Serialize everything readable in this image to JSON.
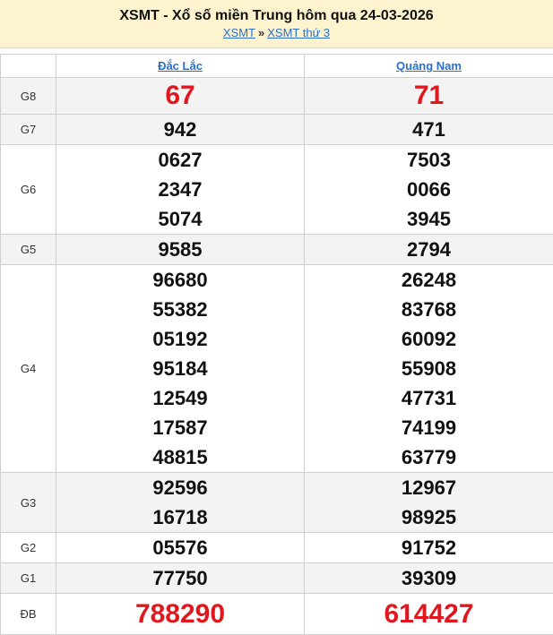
{
  "header": {
    "title": "XSMT - Xổ số miền Trung hôm qua 24-03-2026",
    "breadcrumb": [
      "XSMT",
      "XSMT thứ 3"
    ],
    "separator": "»"
  },
  "provinces": [
    "Đắc Lắc",
    "Quảng Nam"
  ],
  "rows": [
    {
      "label": "G8",
      "cells": [
        [
          "67"
        ],
        [
          "71"
        ]
      ]
    },
    {
      "label": "G7",
      "cells": [
        [
          "942"
        ],
        [
          "471"
        ]
      ]
    },
    {
      "label": "G6",
      "cells": [
        [
          "0627",
          "2347",
          "5074"
        ],
        [
          "7503",
          "0066",
          "3945"
        ]
      ]
    },
    {
      "label": "G5",
      "cells": [
        [
          "9585"
        ],
        [
          "2794"
        ]
      ]
    },
    {
      "label": "G4",
      "cells": [
        [
          "96680",
          "55382",
          "05192",
          "95184",
          "12549",
          "17587",
          "48815"
        ],
        [
          "26248",
          "83768",
          "60092",
          "55908",
          "47731",
          "74199",
          "63779"
        ]
      ]
    },
    {
      "label": "G3",
      "cells": [
        [
          "92596",
          "16718"
        ],
        [
          "12967",
          "98925"
        ]
      ]
    },
    {
      "label": "G2",
      "cells": [
        [
          "05576"
        ],
        [
          "91752"
        ]
      ]
    },
    {
      "label": "G1",
      "cells": [
        [
          "77750"
        ],
        [
          "39309"
        ]
      ]
    },
    {
      "label": "ĐB",
      "cells": [
        [
          "788290"
        ],
        [
          "614427"
        ]
      ]
    }
  ],
  "colors": {
    "highlight": "#e0181e",
    "link": "#2a6fc9",
    "header_bg": "#fdf3cf"
  }
}
